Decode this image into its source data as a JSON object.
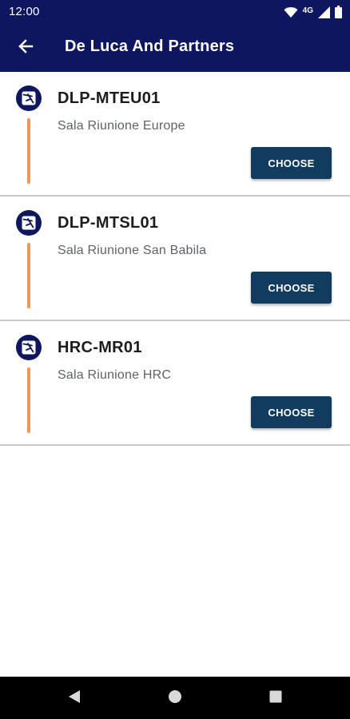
{
  "status_bar": {
    "time": "12:00",
    "network": "4G",
    "icons": [
      "wifi-icon",
      "cellular-signal-icon",
      "battery-icon"
    ]
  },
  "app_bar": {
    "title": "De Luca And Partners",
    "back_icon": "arrow-back-icon"
  },
  "rooms": [
    {
      "code": "DLP-MTEU01",
      "name": "Sala Riunione Europe",
      "button": "CHOOSE"
    },
    {
      "code": "DLP-MTSL01",
      "name": "Sala Riunione San Babila",
      "button": "CHOOSE"
    },
    {
      "code": "HRC-MR01",
      "name": "Sala Riunione HRC",
      "button": "CHOOSE"
    }
  ],
  "nav_bar": {
    "buttons": [
      "back-triangle-icon",
      "home-circle-icon",
      "recents-square-icon"
    ]
  },
  "colors": {
    "primary": "#0f1660",
    "button": "#123b60",
    "accent_line": "#f0965a",
    "divider": "#c8cacc"
  }
}
